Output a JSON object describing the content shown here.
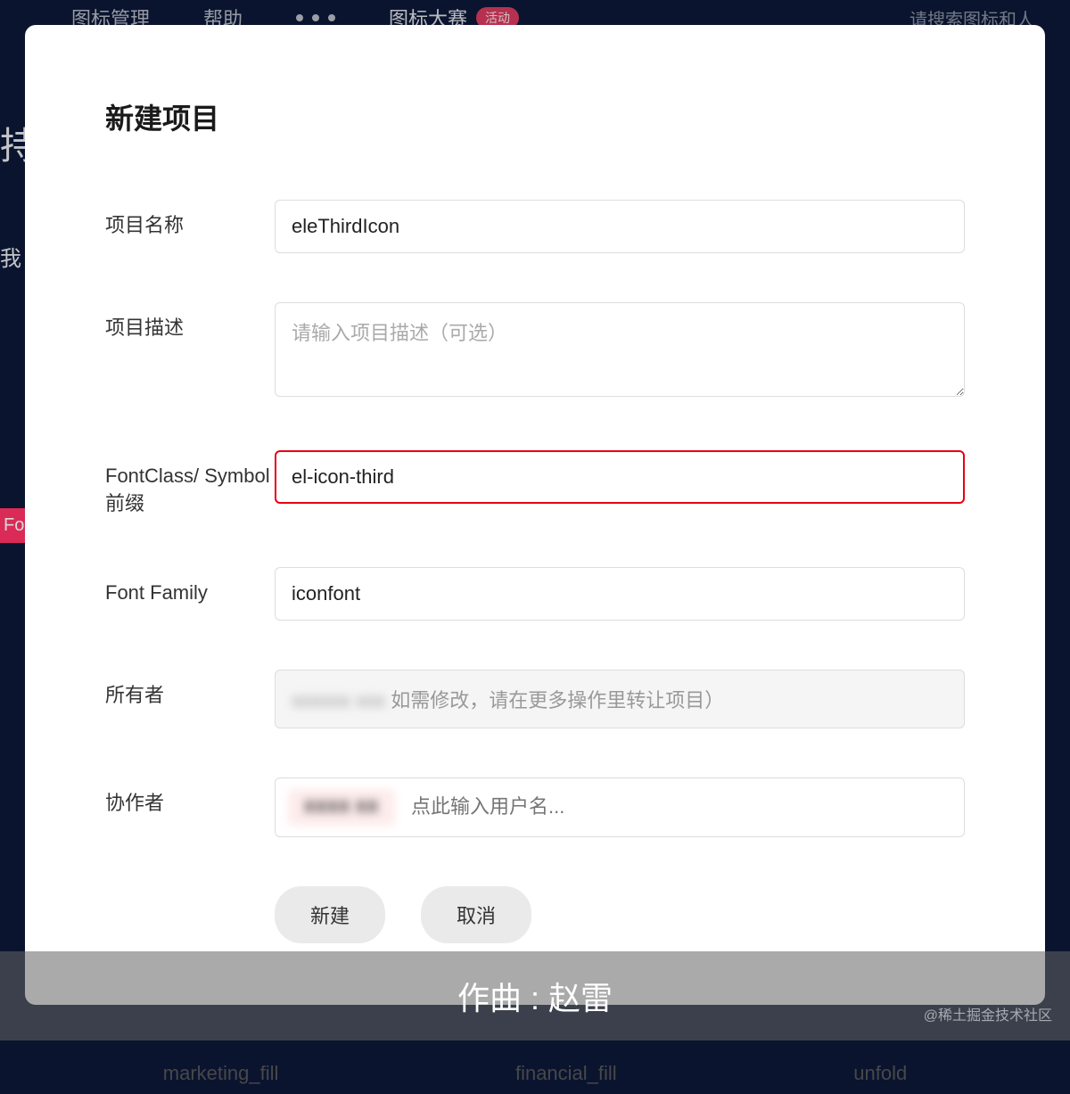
{
  "bg": {
    "nav": {
      "manage": "图标管理",
      "help": "帮助",
      "contest": "图标大赛",
      "badge": "活动",
      "search_hint": "请搜索图标和人"
    },
    "left": {
      "t1": "持",
      "t2": "我"
    },
    "pink_tab": "Fo",
    "bottom_labels": {
      "l1": "marketing_fill",
      "l2": "financial_fill",
      "l3": "unfold"
    }
  },
  "modal": {
    "title": "新建项目",
    "fields": {
      "name": {
        "label": "项目名称",
        "value": "eleThirdIcon"
      },
      "desc": {
        "label": "项目描述",
        "placeholder": "请输入项目描述（可选）"
      },
      "prefix": {
        "label": "FontClass/ Symbol 前缀",
        "value": "el-icon-third"
      },
      "family": {
        "label": "Font Family",
        "value": "iconfont"
      },
      "owner": {
        "label": "所有者",
        "blurred": "xxxxxx xxx",
        "hint": "如需修改，请在更多操作里转让项目）"
      },
      "collaborator": {
        "label": "协作者",
        "chip": "XXXX XX",
        "placeholder": "点此输入用户名..."
      }
    },
    "actions": {
      "create": "新建",
      "cancel": "取消"
    }
  },
  "bottom_bar": {
    "text": "作曲 : 赵雷"
  },
  "watermark": "@稀土掘金技术社区"
}
